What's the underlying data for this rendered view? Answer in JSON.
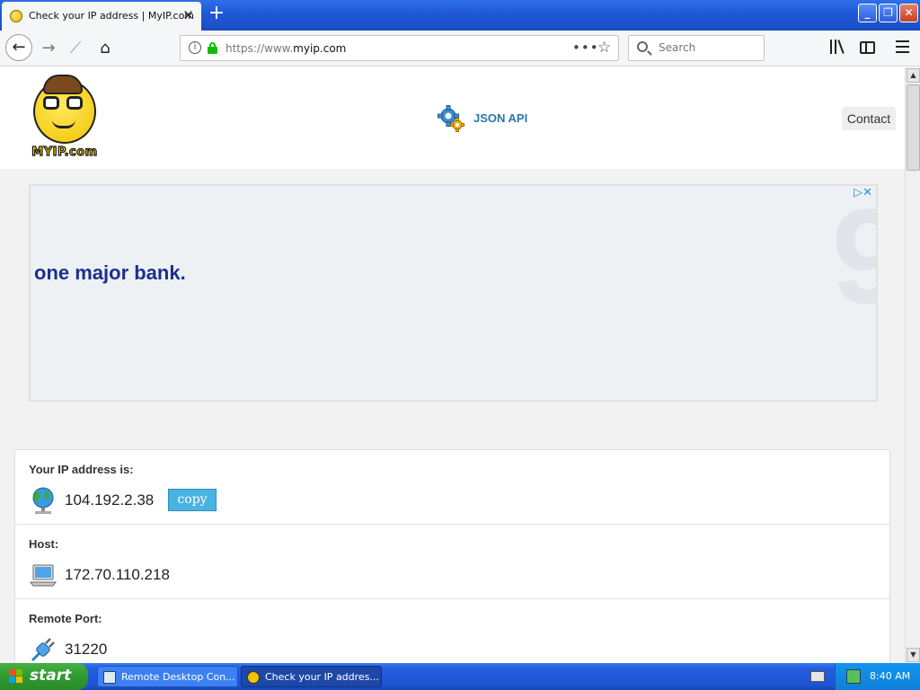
{
  "browser": {
    "tab_title": "Check your IP address | MyIP.com",
    "new_tab_label": "+",
    "url_prefix": "https://www.",
    "url_domain": "myip.com",
    "page_actions": "•••",
    "search_placeholder": "Search"
  },
  "site": {
    "logo_text": "MYIP.com",
    "json_api_label": "JSON API",
    "contact_label": "Contact"
  },
  "ad": {
    "tagline": "one major bank.",
    "big_glyph": "9"
  },
  "ip_info": {
    "ip_label": "Your IP address is:",
    "ip_value": "104.192.2.38",
    "copy_label": "copy",
    "host_label": "Host:",
    "host_value": "172.70.110.218",
    "port_label": "Remote Port:",
    "port_value": "31220"
  },
  "taskbar": {
    "start_label": "start",
    "tasks": [
      {
        "label": "Remote Desktop Con..."
      },
      {
        "label": "Check your IP addres..."
      }
    ],
    "clock": "8:40 AM"
  },
  "colors": {
    "accent_blue": "#2a78a8",
    "copy_button": "#49b3e1",
    "ad_text": "#1b2f8c",
    "lock_green": "#12bc00"
  }
}
